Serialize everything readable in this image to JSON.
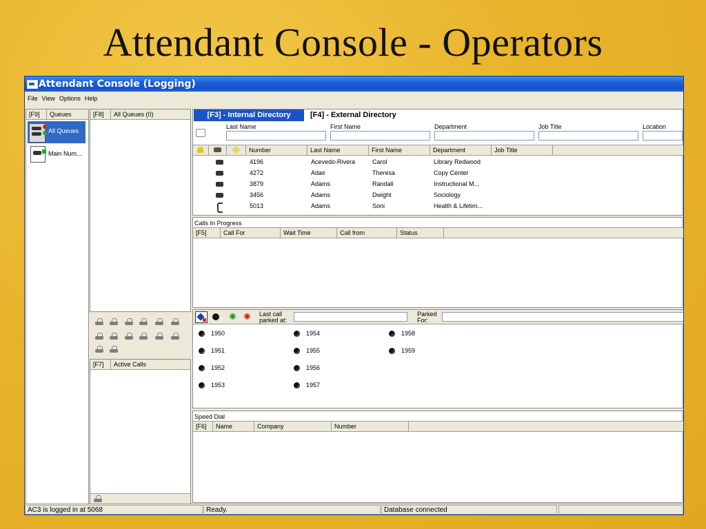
{
  "slide": {
    "title": "Attendant Console - Operators"
  },
  "window": {
    "title": "Attendant Console (Logging)"
  },
  "menu": [
    "File",
    "View",
    "Options",
    "Help"
  ],
  "queues_panel": {
    "key": "[F9]",
    "title": "Queues",
    "items": [
      {
        "label": "All Queues"
      },
      {
        "label": "Main Num..."
      }
    ]
  },
  "all_queues_panel": {
    "key": "[F8]",
    "title": "All Queues (0)"
  },
  "active_calls_panel": {
    "key": "[F7]",
    "title": "Active Calls"
  },
  "directory": {
    "tabs": [
      {
        "label": "[F3] - Internal Directory"
      },
      {
        "label": "[F4] - External Directory"
      }
    ],
    "search_fields": [
      "Last Name",
      "First Name",
      "Department",
      "Job Title",
      "Location"
    ],
    "columns": [
      "Number",
      "Last Name",
      "First Name",
      "Department",
      "Job Title"
    ],
    "rows": [
      {
        "number": "4196",
        "last": "Acevedo-Rivera",
        "first": "Carol",
        "dept": "Library Redwood"
      },
      {
        "number": "4272",
        "last": "Adair",
        "first": "Theresa",
        "dept": "Copy Center"
      },
      {
        "number": "3879",
        "last": "Adams",
        "first": "Randall",
        "dept": "Instructional M..."
      },
      {
        "number": "3456",
        "last": "Adams",
        "first": "Dwight",
        "dept": "Sociology"
      },
      {
        "number": "5013",
        "last": "Adams",
        "first": "Soni",
        "dept": "Health & Lifetim..."
      }
    ]
  },
  "calls_in_progress": {
    "title": "Calls In Progress",
    "columns": [
      "[F5]",
      "Call For",
      "Wait Time",
      "Call from",
      "Status"
    ]
  },
  "parking": {
    "last_call_label_1": "Last call",
    "last_call_label_2": "parked at:",
    "parked_for_label_1": "Parked",
    "parked_for_label_2": "For:",
    "slots": [
      "1950",
      "1951",
      "1952",
      "1953",
      "1954",
      "1955",
      "1956",
      "1957",
      "1958",
      "1959"
    ]
  },
  "speed_dial": {
    "title": "Speed Dial",
    "columns": [
      "[F6]",
      "Name",
      "Company",
      "Number"
    ]
  },
  "status": {
    "login": "AC3 is logged in at 5068",
    "state": "Ready.",
    "db": "Database connected"
  },
  "colors": {
    "titlebar": "#1c5fd8",
    "active_tab": "#1d52c4",
    "slide_bg": "#e9b42c"
  }
}
